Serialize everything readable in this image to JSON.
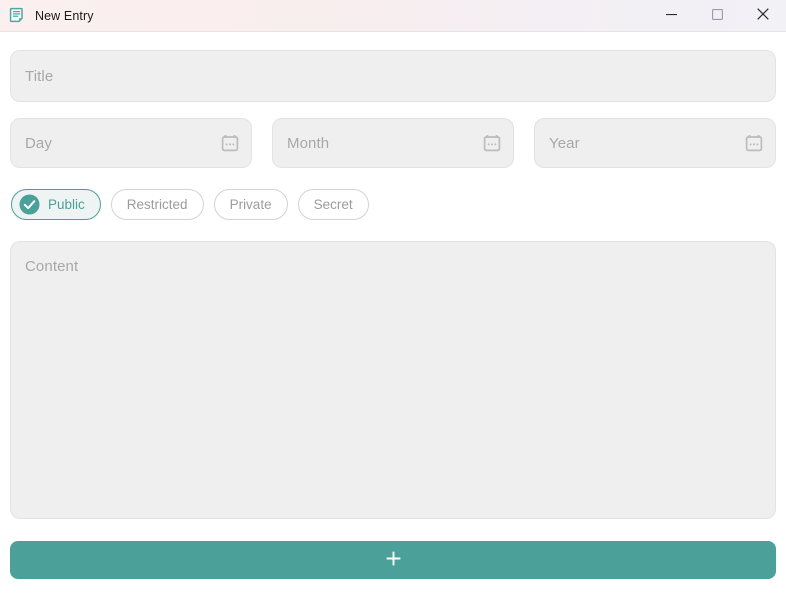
{
  "window": {
    "title": "New Entry",
    "icon": "note-document-icon",
    "controls": {
      "minimize": "minimize-icon",
      "maximize": "maximize-icon",
      "close": "close-icon"
    }
  },
  "form": {
    "title_field": {
      "name": "title-input",
      "value": "",
      "placeholder": "Title"
    },
    "date_fields": [
      {
        "name": "day-input",
        "value": "",
        "placeholder": "Day",
        "icon": "calendar-icon"
      },
      {
        "name": "month-input",
        "value": "",
        "placeholder": "Month",
        "icon": "calendar-icon"
      },
      {
        "name": "year-input",
        "value": "",
        "placeholder": "Year",
        "icon": "calendar-icon"
      }
    ],
    "visibility_chips": [
      {
        "label": "Public",
        "selected": true,
        "icon": "check-circle-icon"
      },
      {
        "label": "Restricted",
        "selected": false,
        "icon": ""
      },
      {
        "label": "Private",
        "selected": false,
        "icon": ""
      },
      {
        "label": "Secret",
        "selected": false,
        "icon": ""
      }
    ],
    "content_field": {
      "name": "content-textarea",
      "value": "",
      "placeholder": "Content"
    },
    "submit_button": {
      "name": "add-entry-button",
      "label": "+",
      "icon": "plus-icon"
    }
  },
  "colors": {
    "accent_teal": "#4ba099",
    "accent_teal_soft": "#eef4f3",
    "field_bg": "#efefef",
    "field_border": "#e3e3e3",
    "placeholder_text": "#a8a8a8",
    "chip_border": "#d3d3d3",
    "chip_text": "#9c9c9c",
    "titlebar_left": "#fbf0ef",
    "titlebar_right": "#f1f1f6",
    "title_text": "#1b1b1b",
    "page_bg": "#ffffff"
  }
}
